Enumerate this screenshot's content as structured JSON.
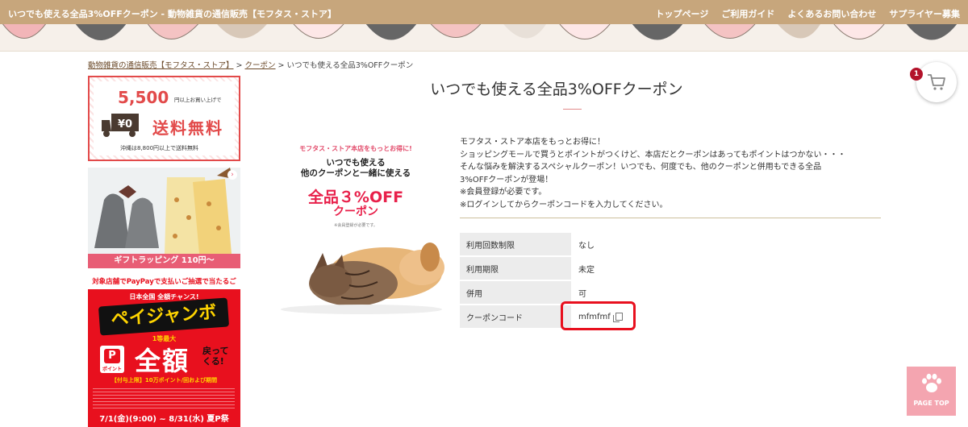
{
  "header": {
    "site_title": "いつでも使える全品3%OFFクーポン - 動物雑貨の通信販売【モフタス・ストア】",
    "nav": [
      "トップページ",
      "ご利用ガイド",
      "よくあるお問い合わせ",
      "サプライヤー募集"
    ]
  },
  "breadcrumb": {
    "home": "動物雑貨の通信販売【モフタス・ストア】",
    "sep": " > ",
    "category": "クーポン",
    "current": "いつでも使える全品3%OFFクーポン"
  },
  "sidebar": {
    "shipping": {
      "amount": "5,500",
      "amount_note": "円以上お買い上げで",
      "truck_text": "¥0",
      "free_text": "送料無料",
      "okinawa": "沖縄は8,800円以上で送料無料"
    },
    "gift": {
      "label": "ギフトラッピング 110円〜",
      "arrow": "›"
    },
    "paypay": {
      "strip": "対象店舗でPayPayで支払いご抽選で当たるご",
      "title": "日本全国 全額チャンス!",
      "jumbo": "ペイジャンボ",
      "prize": "1等最大",
      "logo_p": "P",
      "logo_label": "ポイント",
      "zengaku": "全額",
      "back": "戻って\nくる!",
      "condition": "【付与上限】10万ポイント/回および期間",
      "dates": "7/1(金)(9:00) ~ 8/31(水) 夏P祭"
    }
  },
  "main": {
    "title": "いつでも使える全品3%OFFクーポン",
    "image": {
      "line1": "モフタス・ストア本店をもっとお得に!",
      "line2a": "いつでも使える",
      "line2b": "他のクーポンと一緒に使える",
      "line3": "全品３%OFF",
      "line4": "クーポン",
      "line5": "※会員登録が必要です。"
    },
    "description": [
      "モフタス・ストア本店をもっとお得に！",
      "ショッピングモールで買うとポイントがつくけど、本店だとクーポンはあってもポイントはつかない・・・",
      "そんな悩みを解決するスペシャルクーポン！いつでも、何度でも、他のクーポンと併用もできる全品",
      "3%OFFクーポンが登場！",
      "※会員登録が必要です。",
      "※ログインしてからクーポンコードを入力してください。"
    ],
    "table": [
      {
        "label": "利用回数制限",
        "value": "なし"
      },
      {
        "label": "利用期限",
        "value": "未定"
      },
      {
        "label": "併用",
        "value": "可"
      },
      {
        "label": "クーポンコード",
        "value": "mfmfmf"
      }
    ]
  },
  "cart": {
    "count": "1"
  },
  "page_top": {
    "label": "PAGE TOP"
  },
  "colors": {
    "header_bg": "#c7a67c",
    "accent_red": "#e8101e",
    "page_top_bg": "#f4a5b0"
  }
}
